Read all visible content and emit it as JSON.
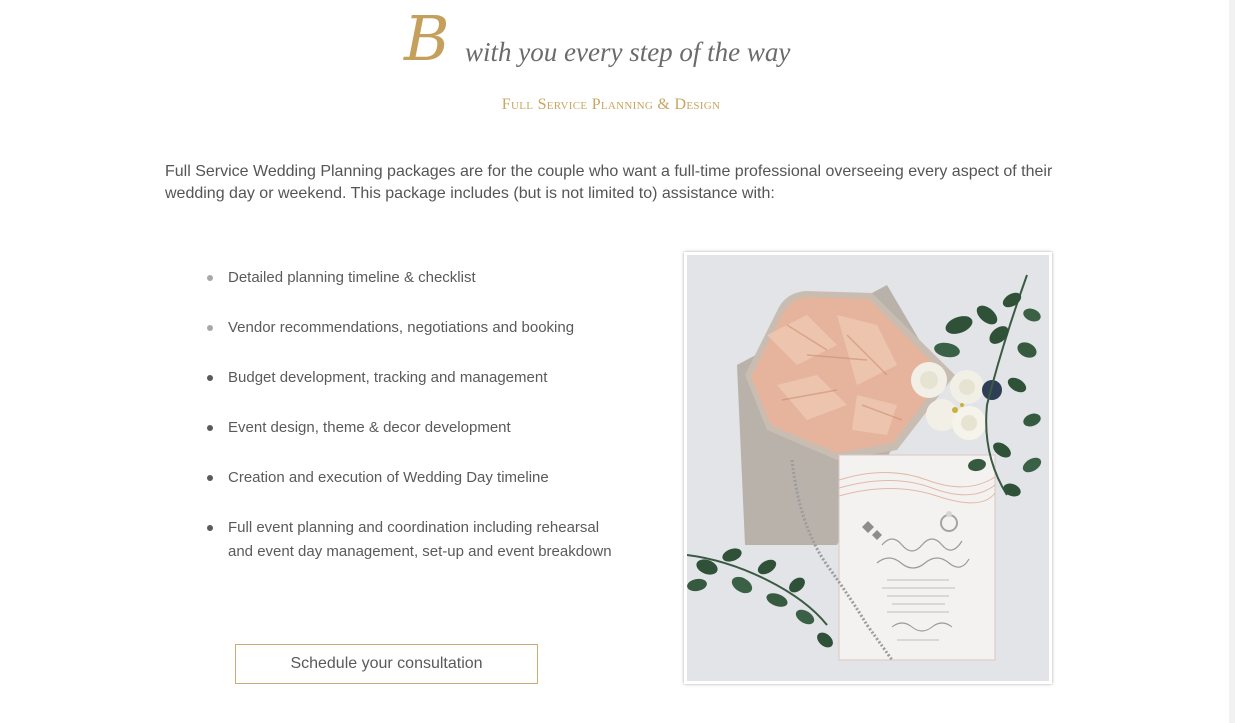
{
  "heading": {
    "monogram": "B",
    "tagline": "with you every step of the way"
  },
  "subheading": "Full Service Planning & Design",
  "intro": "Full Service Wedding Planning packages are for the couple who want a full-time professional overseeing every aspect of their wedding day or weekend.  This package includes (but is not limited to) assistance with:",
  "services": [
    "Detailed planning timeline & checklist",
    "Vendor recommendations, negotiations and booking",
    "Budget development, tracking and management",
    "Event design, theme & decor development",
    "Creation and execution of Wedding Day timeline",
    "Full event planning and coordination including rehearsal and event day management, set-up and event breakdown"
  ],
  "cta_label": "Schedule your consultation",
  "photo": {
    "icon": "wedding-invitation-photo",
    "colors": {
      "background": "#dfe1e6",
      "envelope": "#b9b2aa",
      "foil": "#e6b49c",
      "card": "#f4f2f0",
      "leaf": "#2f5138",
      "rose": "#f2f0e6"
    }
  },
  "colors": {
    "gold": "#c4a05c",
    "text": "#5a5a5a"
  }
}
